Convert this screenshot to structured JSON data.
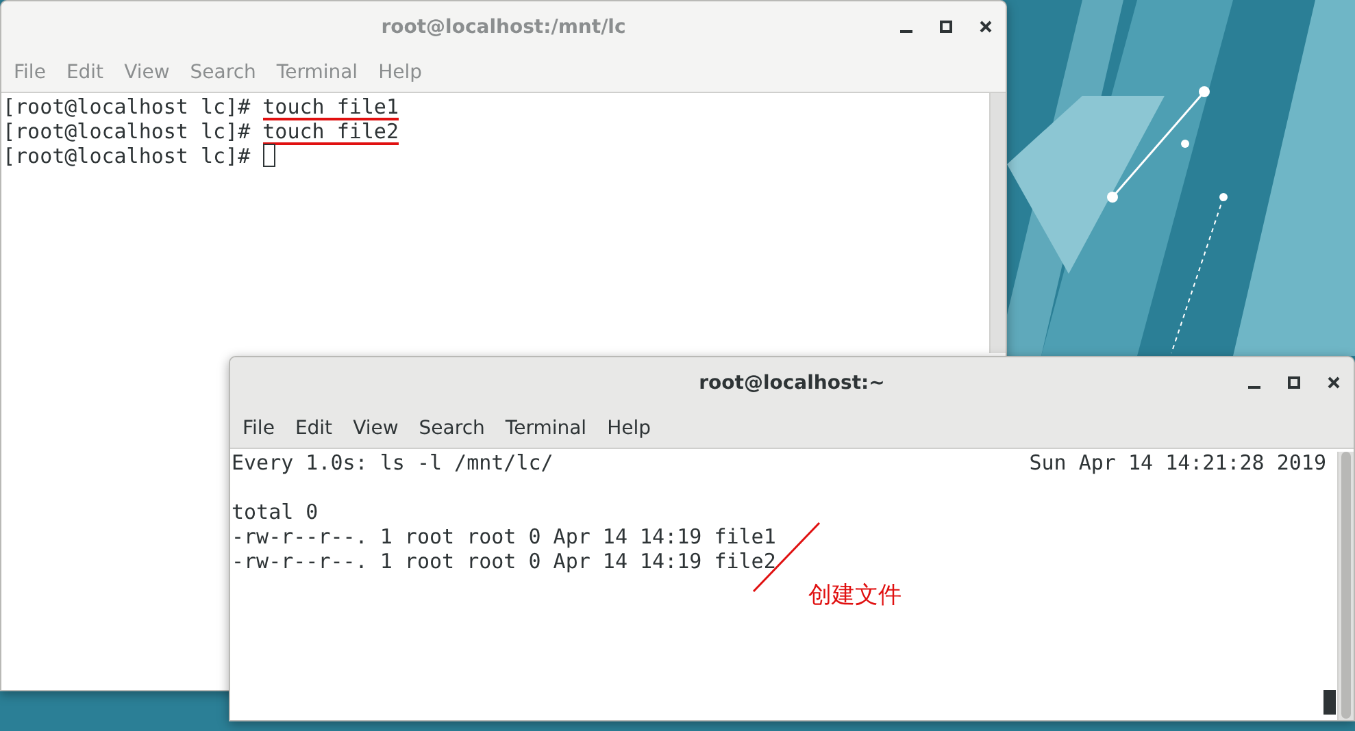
{
  "windows": [
    {
      "title": "root@localhost:/mnt/lc",
      "active": false,
      "menu": [
        "File",
        "Edit",
        "View",
        "Search",
        "Terminal",
        "Help"
      ],
      "cursor": true,
      "lines": [
        {
          "prompt": "[root@localhost lc]# ",
          "command": "touch file1",
          "underlined": true
        },
        {
          "prompt": "[root@localhost lc]# ",
          "command": "touch file2",
          "underlined": true
        },
        {
          "prompt": "[root@localhost lc]# "
        }
      ]
    },
    {
      "title": "root@localhost:~",
      "active": true,
      "menu": [
        "File",
        "Edit",
        "View",
        "Search",
        "Terminal",
        "Help"
      ],
      "cursor": true,
      "header": {
        "left": "Every 1.0s: ls -l /mnt/lc/",
        "right": "Sun Apr 14 14:21:28 2019"
      },
      "lines": [
        {
          "command": "total 0"
        },
        {
          "command": "-rw-r--r--. 1 root root 0 Apr 14 14:19 file1"
        },
        {
          "command": "-rw-r--r--. 1 root root 0 Apr 14 14:19 file2"
        }
      ]
    }
  ],
  "annotation": {
    "text": "创建文件"
  }
}
